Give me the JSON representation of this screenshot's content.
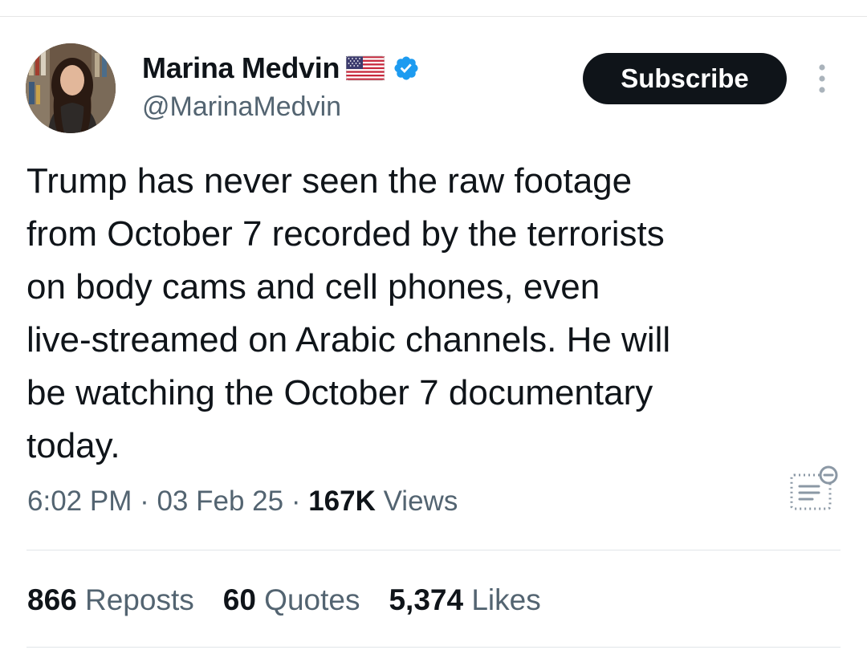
{
  "author": {
    "display_name": "Marina Medvin",
    "handle": "@MarinaMedvin",
    "flag_icon": "us-flag-icon",
    "verified_icon": "verified-badge-icon",
    "verified_color": "#1d9bf0"
  },
  "header": {
    "subscribe_label": "Subscribe",
    "more_icon": "more-vertical-icon"
  },
  "tweet": {
    "text": "Trump has never seen the raw footage\nfrom October 7 recorded by the terrorists\non body cams and cell phones, even\nlive-streamed on Arabic channels. He will\nbe watching the October 7 documentary\ntoday.",
    "time": "6:02 PM",
    "separator": " · ",
    "date": "03 Feb 25",
    "views_count": "167K",
    "views_label": " Views"
  },
  "stats": {
    "reposts_count": "866",
    "reposts_label": " Reposts",
    "quotes_count": "60",
    "quotes_label": " Quotes",
    "likes_count": "5,374",
    "likes_label": " Likes"
  },
  "colors": {
    "text_primary": "#0f1419",
    "text_secondary": "#536471",
    "button_bg": "#0f1419"
  }
}
